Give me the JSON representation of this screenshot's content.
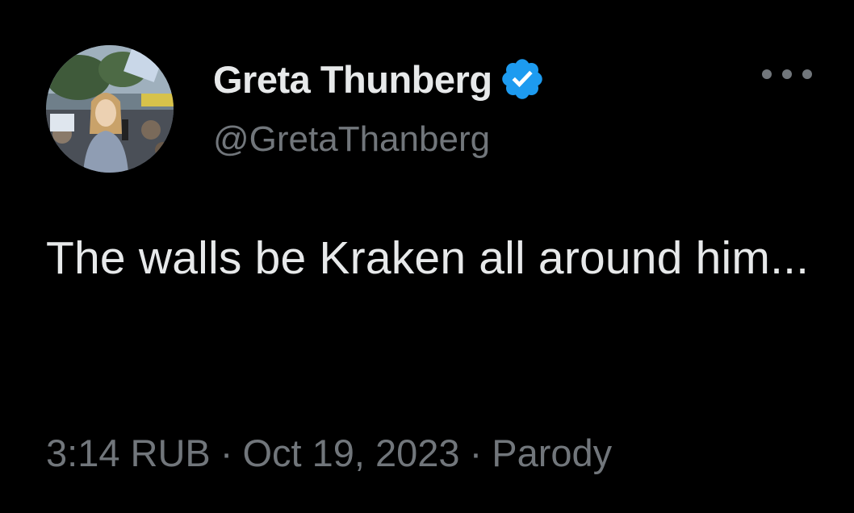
{
  "author": {
    "display_name": "Greta Thunberg",
    "handle": "@GretaThanberg",
    "verified": true,
    "avatar_icon": "profile-photo-protest-crowd"
  },
  "tweet": {
    "text": "The walls be Kraken all around him..."
  },
  "meta": {
    "time": "3:14 RUB",
    "separator": "·",
    "date": "Oct 19, 2023",
    "label": "Parody"
  },
  "icons": {
    "verified": "verified-badge-icon",
    "more": "more-options-icon"
  },
  "colors": {
    "background": "#000000",
    "primary_text": "#e7e9ea",
    "secondary_text": "#71767b",
    "verified_blue": "#1d9bf0"
  }
}
